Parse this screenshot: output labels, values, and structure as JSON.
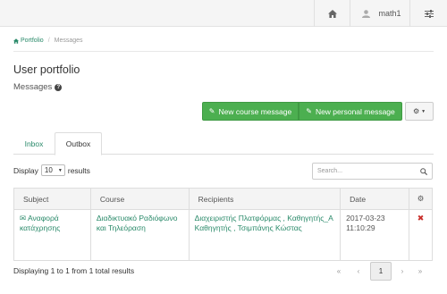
{
  "topbar": {
    "home_icon": "home-icon",
    "username": "math1",
    "user_icon": "user-icon",
    "menu_icon": "sliders-icon"
  },
  "breadcrumb": {
    "portfolio": "Portfolio",
    "current": "Messages"
  },
  "page": {
    "title": "User portfolio",
    "subtitle": "Messages"
  },
  "actions": {
    "new_course_message": "New course message",
    "new_personal_message": "New personal message"
  },
  "tabs": [
    {
      "label": "Inbox",
      "active": false
    },
    {
      "label": "Outbox",
      "active": true
    }
  ],
  "list_controls": {
    "display_prefix": "Display",
    "page_size": "10",
    "display_suffix": "results",
    "search_placeholder": "Search..."
  },
  "table": {
    "columns": [
      "Subject",
      "Course",
      "Recipients",
      "Date"
    ],
    "rows": [
      {
        "subject": "Αναφορά κατάχρησης",
        "course": "Διαδικτυακό Ραδιόφωνο και Τηλεόραση",
        "recipients": "Διαχειριστής Πλατφόρμας , Καθηγητής_Α Καθηγητής , Τσιμπάνης Κώστας",
        "date": "2017-03-23 11:10:29"
      }
    ]
  },
  "footer": {
    "info": "Displaying 1 to 1 from 1 total results",
    "current_page": "1"
  },
  "colors": {
    "accent_green": "#4caf50",
    "link_green": "#2a8a6a",
    "delete_red": "#c9302c"
  }
}
